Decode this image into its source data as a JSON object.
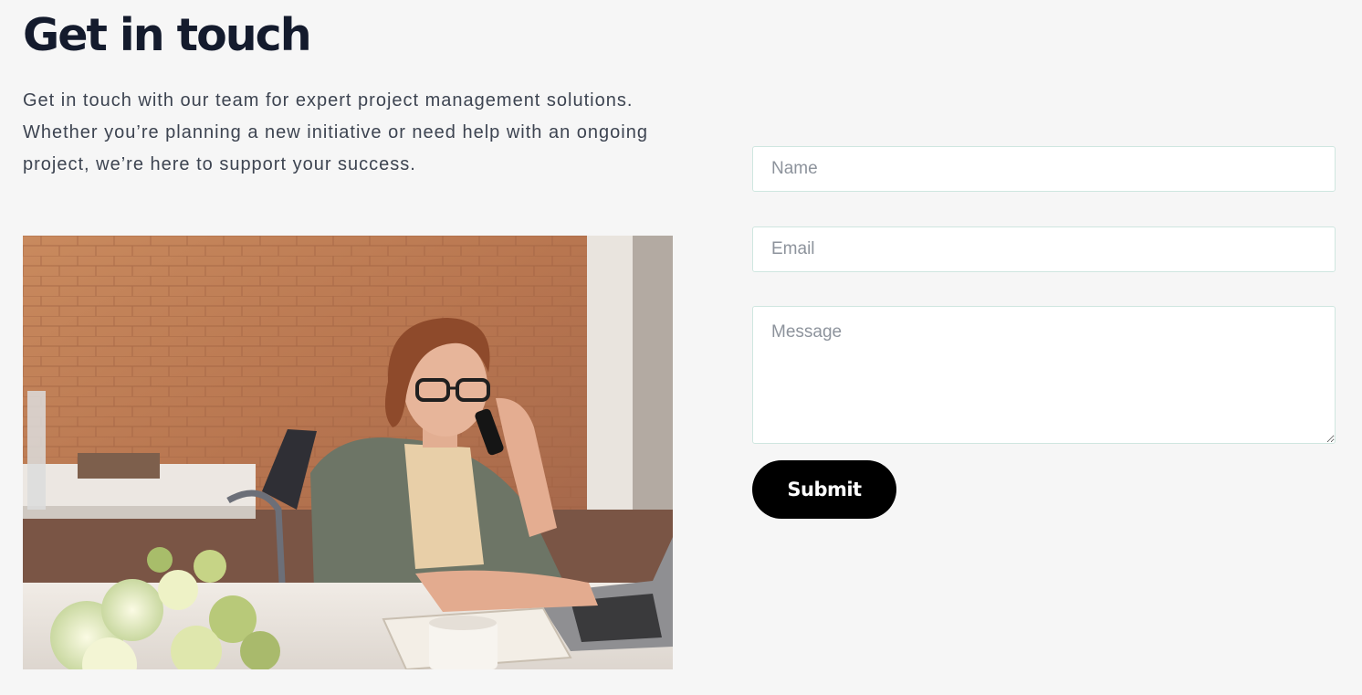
{
  "header": {
    "title": "Get in touch"
  },
  "intro": {
    "text": "Get in touch with our team for expert project management solutions. Whether you’re planning a new initiative or need help with an ongoing project, we’re here to support your success."
  },
  "form": {
    "name_placeholder": "Name",
    "email_placeholder": "Email",
    "message_placeholder": "Message",
    "submit_label": "Submit"
  },
  "colors": {
    "background": "#f6f6f6",
    "heading": "#141b2d",
    "body_text": "#3d4451",
    "input_border": "#cfe6e0",
    "button": "#000000"
  }
}
